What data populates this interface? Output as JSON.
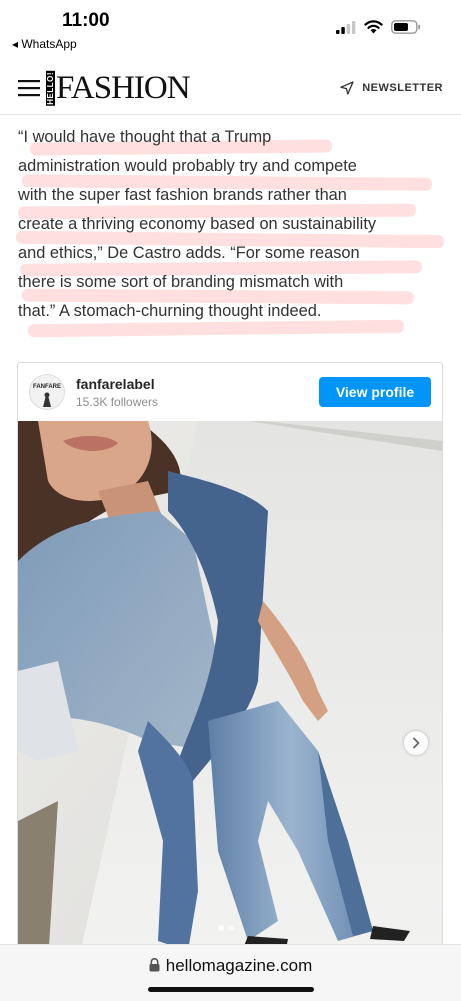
{
  "status_bar": {
    "time": "11:00",
    "back_app": "◂ WhatsApp"
  },
  "header": {
    "logo_hello": "HELLO!",
    "logo_fashion": "FASHION",
    "newsletter_label": "NEWSLETTER"
  },
  "article": {
    "quote_lines": [
      "“I would have thought that a Trump",
      "administration would probably try and compete",
      "with the super fast fashion brands rather than",
      "create a thriving economy based on sustainability",
      "and ethics,” De Castro adds. “For some reason",
      "there is some sort of branding mismatch with",
      "that.” A stomach-churning thought indeed."
    ],
    "highlight_color": "#ff8c8c"
  },
  "instagram": {
    "avatar_text": "FANFARE",
    "username": "fanfarelabel",
    "followers": "15.3K followers",
    "view_profile": "View profile",
    "button_color": "#0095f6",
    "carousel_dots": 2,
    "active_dot": 0
  },
  "browser": {
    "url": "hellomagazine.com"
  }
}
